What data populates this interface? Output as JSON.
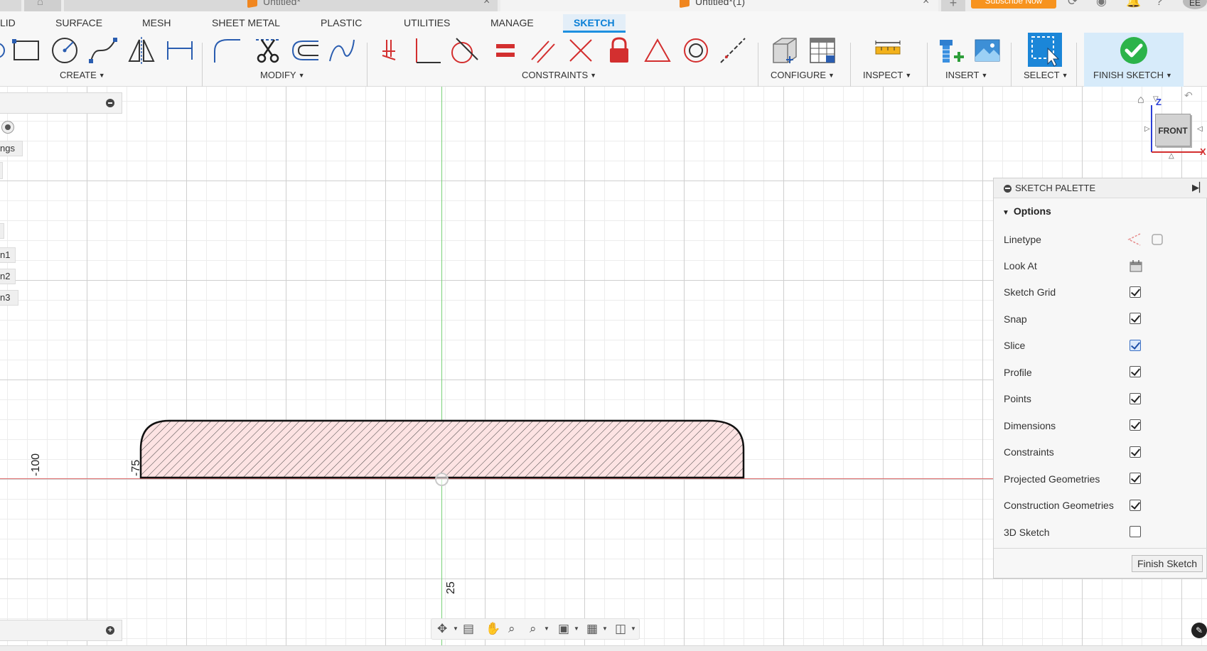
{
  "tabs": {
    "doc1_title": "Untitled*",
    "doc2_title": "Untitled*(1)",
    "subscribe_label": "Subscribe Now",
    "user_initials": "EE"
  },
  "workspaces": [
    {
      "label": "LID"
    },
    {
      "label": "SURFACE"
    },
    {
      "label": "MESH"
    },
    {
      "label": "SHEET METAL"
    },
    {
      "label": "PLASTIC"
    },
    {
      "label": "UTILITIES"
    },
    {
      "label": "MANAGE"
    },
    {
      "label": "SKETCH"
    }
  ],
  "groups": {
    "create": "CREATE",
    "modify": "MODIFY",
    "constraints": "CONSTRAINTS",
    "configure": "CONFIGURE",
    "inspect": "INSPECT",
    "insert": "INSERT",
    "select": "SELECT",
    "finish": "FINISH SKETCH"
  },
  "sidebar": {
    "settings_stub": "ngs",
    "item1": "n1",
    "item2": "n2",
    "item3": "n3"
  },
  "canvas": {
    "dim_left": "-100",
    "dim_profile": "-75",
    "dim_bottom": "25",
    "profile_fill": "#fde3e3",
    "axis_x_color": "#e07070",
    "axis_y_color": "#79d279"
  },
  "viewcube": {
    "face": "FRONT",
    "z_label": "Z",
    "x_label": "X"
  },
  "palette": {
    "title": "SKETCH PALETTE",
    "options_label": "Options",
    "rows": [
      {
        "label": "Linetype",
        "type": "icons"
      },
      {
        "label": "Look At",
        "type": "icon"
      },
      {
        "label": "Sketch Grid",
        "type": "check",
        "checked": true
      },
      {
        "label": "Snap",
        "type": "check",
        "checked": true
      },
      {
        "label": "Slice",
        "type": "check",
        "checked": true
      },
      {
        "label": "Profile",
        "type": "check",
        "checked": true
      },
      {
        "label": "Points",
        "type": "check",
        "checked": true
      },
      {
        "label": "Dimensions",
        "type": "check",
        "checked": true
      },
      {
        "label": "Constraints",
        "type": "check",
        "checked": true
      },
      {
        "label": "Projected Geometries",
        "type": "check",
        "checked": true
      },
      {
        "label": "Construction Geometries",
        "type": "check",
        "checked": true
      },
      {
        "label": "3D Sketch",
        "type": "check",
        "checked": false
      }
    ],
    "finish_button": "Finish Sketch"
  }
}
